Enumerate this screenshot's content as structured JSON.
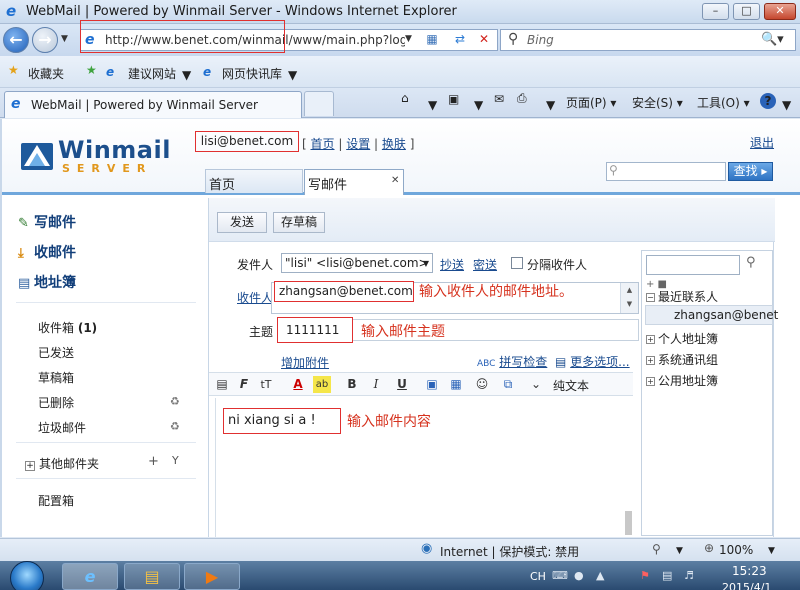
{
  "window": {
    "title": "WebMail | Powered by Winmail Server - Windows Internet Explorer",
    "min_label": "0",
    "max_label": "1",
    "close_label": "X"
  },
  "addressbar": {
    "url": "http://www.benet.com/winmail/www/main.php?log",
    "search_engine": "Bing"
  },
  "favorites": {
    "label": "收藏夹",
    "items": [
      "建议网站",
      "网页快讯库"
    ]
  },
  "tabs": {
    "active": "WebMail | Powered by Winmail Server"
  },
  "commandbar": {
    "page": "页面(P)",
    "safety": "安全(S)",
    "tools": "工具(O)",
    "help": "?"
  },
  "webmail": {
    "logo_text": "Winmail",
    "logo_sub": "SERVER",
    "user": "lisi@benet.com",
    "links": [
      "首页",
      "设置",
      "换肤"
    ],
    "logout": "退出",
    "search_button": "查找",
    "tabs": [
      "首页",
      "写邮件"
    ],
    "sidebar": {
      "main": [
        "写邮件",
        "收邮件",
        "地址簿"
      ],
      "folders": [
        {
          "name": "收件箱",
          "count": "(1)"
        },
        {
          "name": "已发送"
        },
        {
          "name": "草稿箱"
        },
        {
          "name": "已删除"
        },
        {
          "name": "垃圾邮件"
        }
      ],
      "other_folders": "其他邮件夹",
      "settings": "配置箱"
    },
    "compose": {
      "send": "发送",
      "save_draft": "存草稿",
      "from_label": "发件人",
      "from_value": "\"lisi\" <lisi@benet.com>",
      "cc": "抄送",
      "bcc": "密送",
      "separate": "分隔收件人",
      "to_label": "收件人",
      "to_value": "zhangsan@benet.com",
      "to_hint": "输入收件人的邮件地址。",
      "subject_label": "主题",
      "subject_value": "1111111",
      "subject_hint": "输入邮件主题",
      "attach": "增加附件",
      "spell_check": "拼写检查",
      "more_options": "更多选项...",
      "plain_text": "纯文本",
      "body_value": "ni xiang si a !",
      "body_hint": "输入邮件内容"
    },
    "contacts": {
      "tree": [
        "最近联系人",
        "个人地址簿",
        "系统通讯组",
        "公用地址簿"
      ],
      "recent": [
        "zhangsan@benet"
      ]
    }
  },
  "statusbar": {
    "zone": "Internet | 保护模式: 禁用",
    "zoom": "100%"
  },
  "taskbar": {
    "lang": "CH",
    "time": "15:23",
    "date": "2015/4/1"
  }
}
